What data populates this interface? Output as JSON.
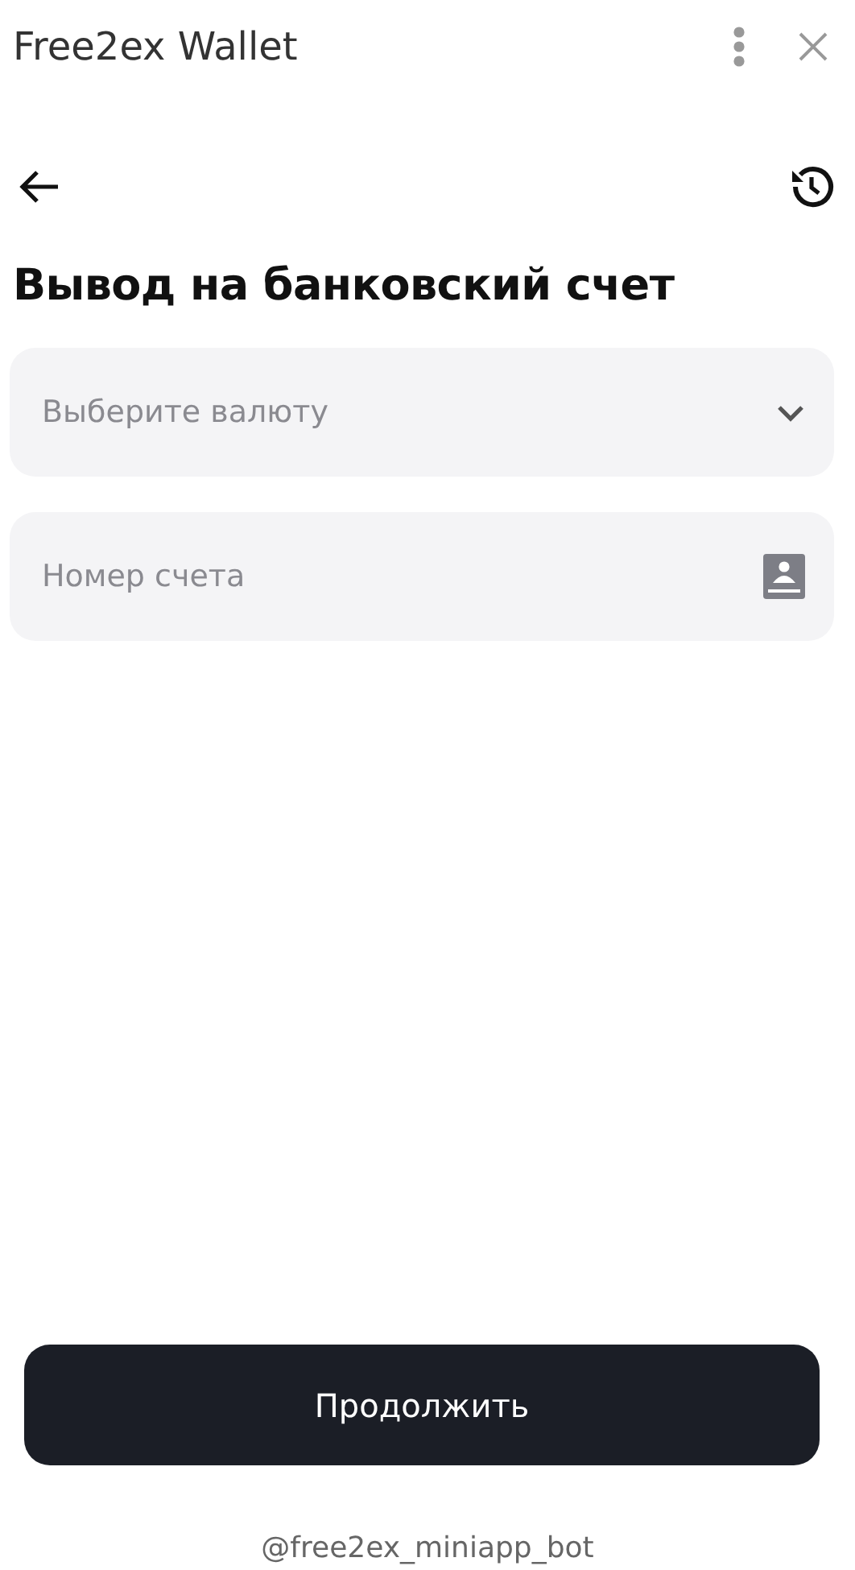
{
  "window": {
    "title": "Free2ex Wallet"
  },
  "heading": "Вывод на банковский счет",
  "fields": [
    {
      "kind": "select",
      "placeholder": "Выберите валюту"
    },
    {
      "kind": "account",
      "placeholder": "Номер счета"
    }
  ],
  "button": "Продолжить",
  "footer": "@free2ex_miniapp_bot"
}
